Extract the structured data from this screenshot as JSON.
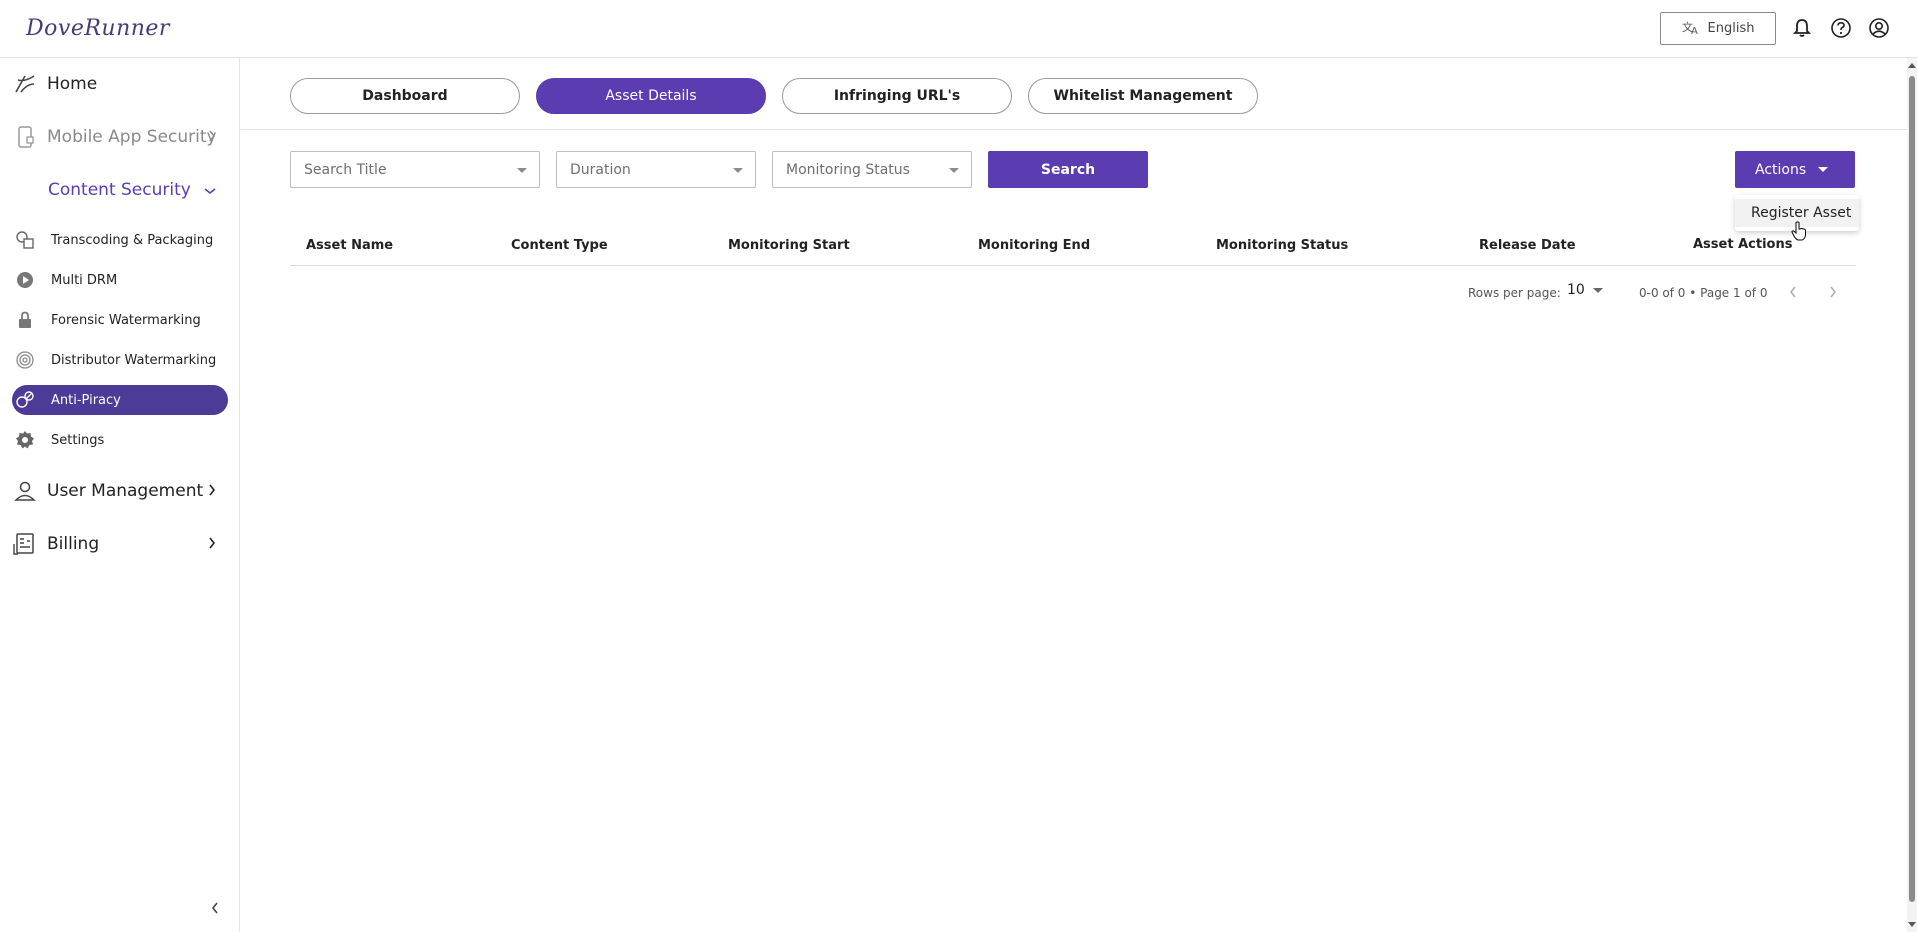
{
  "header": {
    "logo": "DoveRunner",
    "language": "English"
  },
  "sidebar": {
    "home": "Home",
    "mobile_app_security": "Mobile App Security",
    "content_security": "Content Security",
    "sub_items": [
      {
        "label": "Transcoding & Packaging"
      },
      {
        "label": "Multi DRM"
      },
      {
        "label": "Forensic Watermarking"
      },
      {
        "label": "Distributor Watermarking"
      },
      {
        "label": "Anti-Piracy"
      },
      {
        "label": "Settings"
      }
    ],
    "user_management": "User Management",
    "billing": "Billing",
    "active_item": "Anti-Piracy"
  },
  "tabs": [
    {
      "label": "Dashboard"
    },
    {
      "label": "Asset Details"
    },
    {
      "label": "Infringing URL's"
    },
    {
      "label": "Whitelist Management"
    }
  ],
  "active_tab": "Asset Details",
  "filters": {
    "title_placeholder": "Search Title",
    "duration_placeholder": "Duration",
    "status_placeholder": "Monitoring Status",
    "search_label": "Search"
  },
  "actions": {
    "label": "Actions",
    "menu_items": [
      "Register Asset"
    ]
  },
  "table": {
    "columns": [
      "Asset Name",
      "Content Type",
      "Monitoring Start",
      "Monitoring End",
      "Monitoring Status",
      "Release Date",
      "Asset Actions"
    ],
    "rows": []
  },
  "pagination": {
    "rows_per_page_label": "Rows per page:",
    "rows_per_page": "10",
    "range": "0-0 of 0 • Page 1 of 0"
  },
  "colors": {
    "accent": "#5b3cb1",
    "sidebar_active": "#4e3a97",
    "section_text": "#5c3cb0"
  }
}
